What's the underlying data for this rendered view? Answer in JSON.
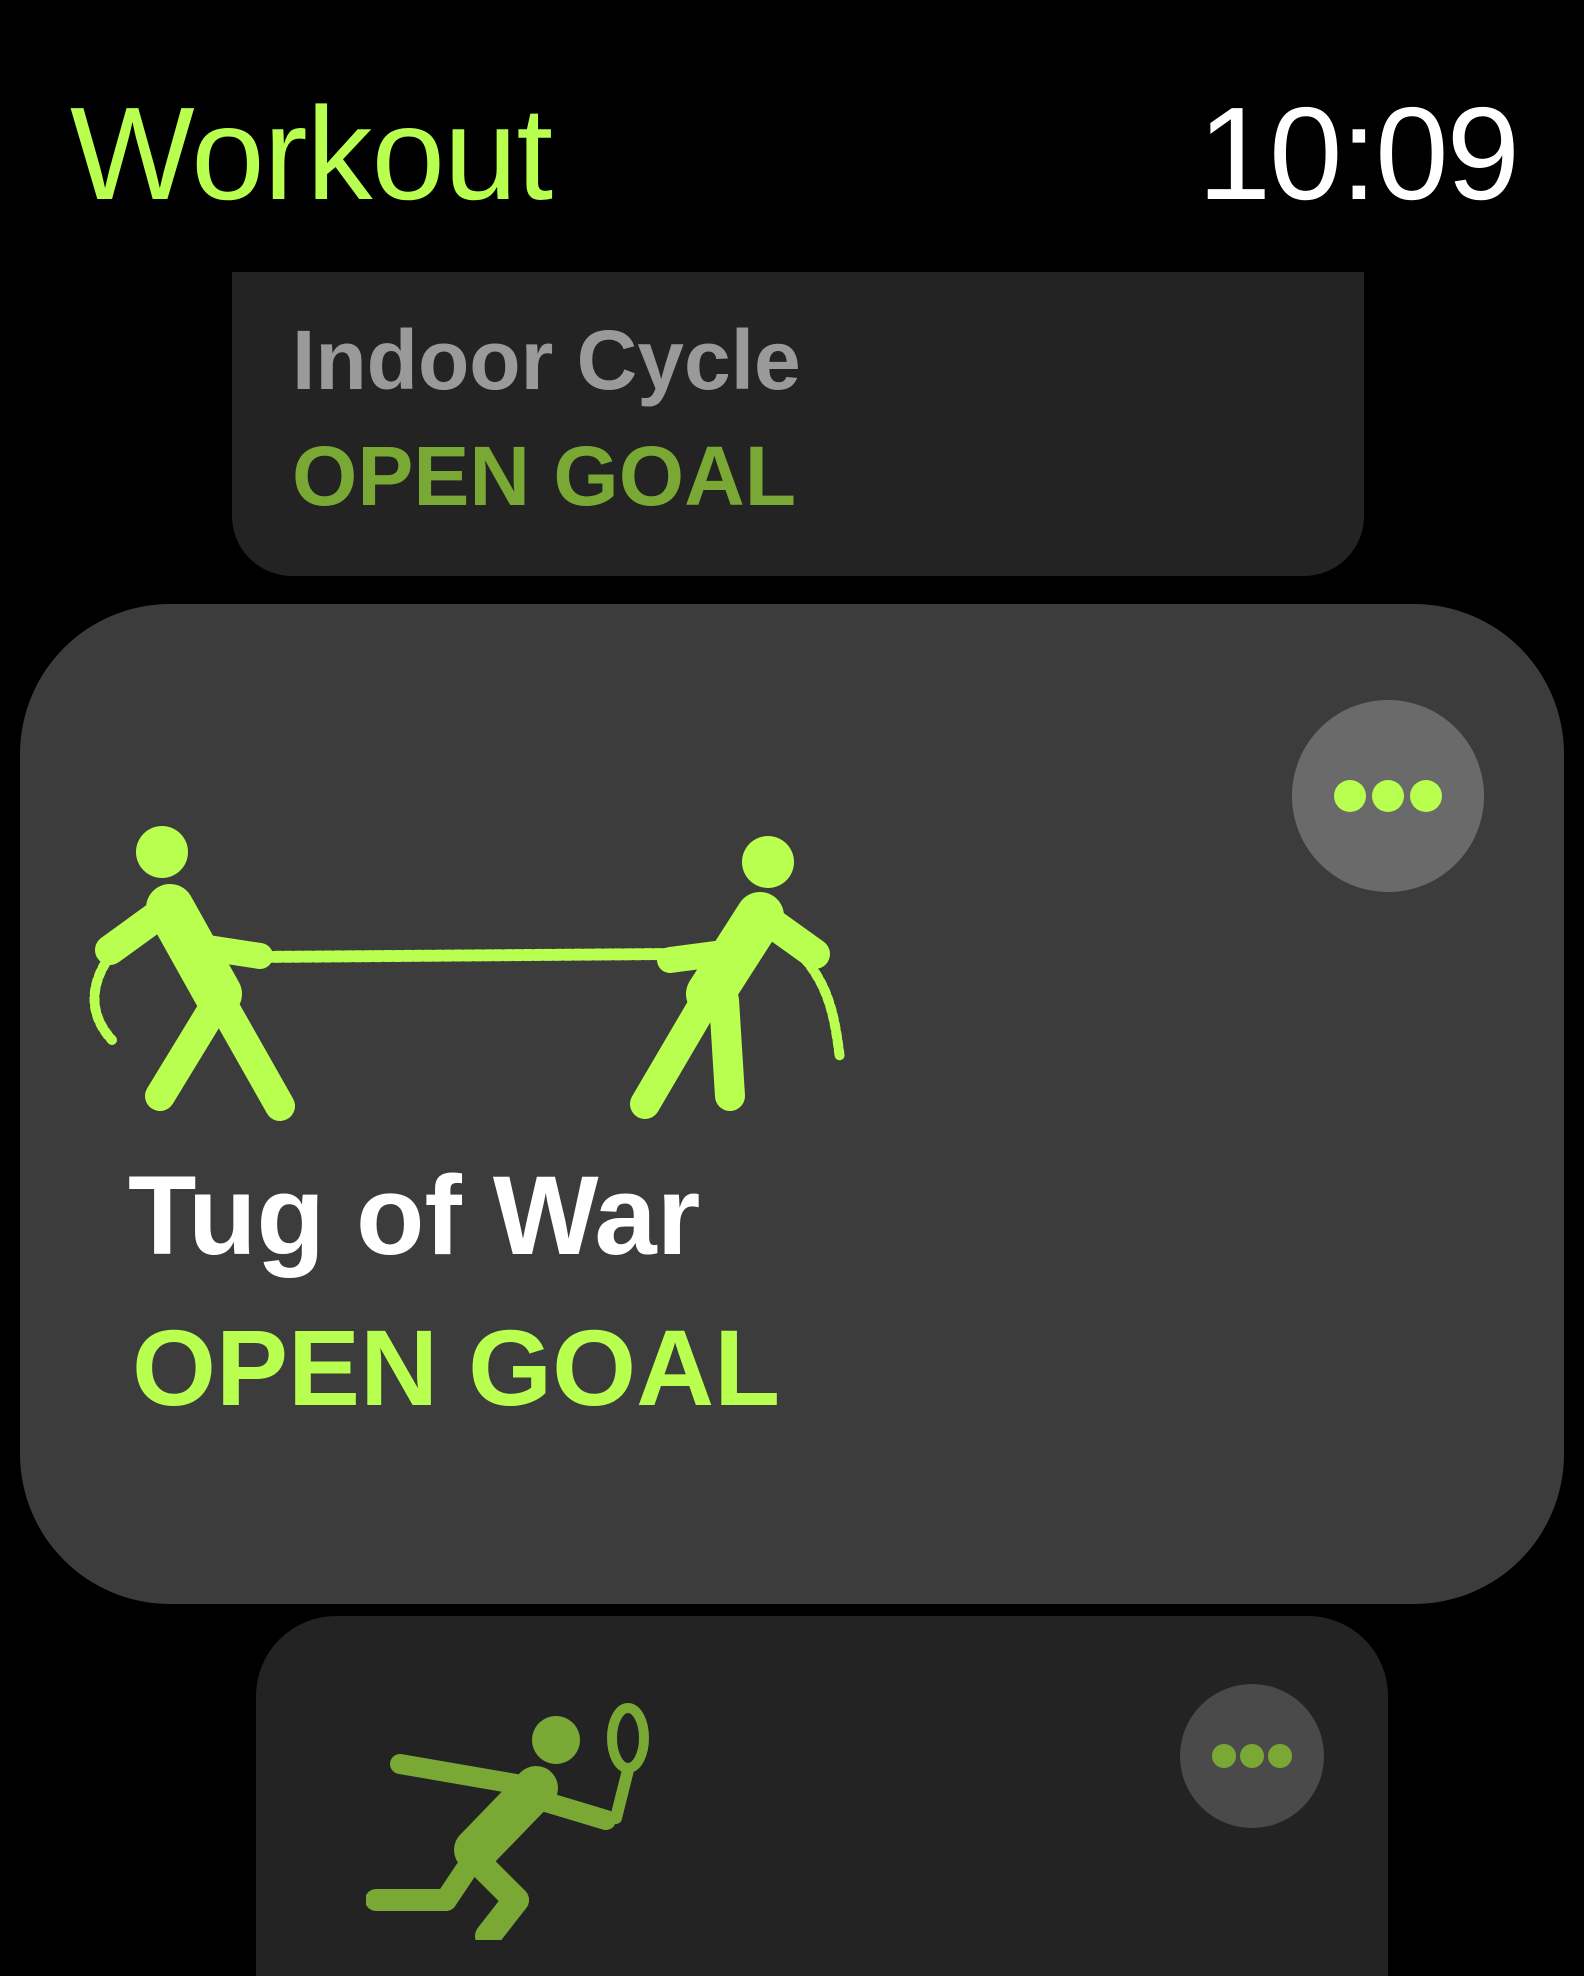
{
  "header": {
    "app_title": "Workout",
    "time": "10:09"
  },
  "colors": {
    "accent": "#b9ff4f",
    "accent_dim": "#7aa834",
    "card_bg": "#3c3c3c",
    "card_bg_dim": "#232323",
    "muted_text": "#9a9a9a"
  },
  "workouts": [
    {
      "title": "Indoor Cycle",
      "goal": "OPEN GOAL",
      "icon": "indoor-cycle-icon"
    },
    {
      "title": "Tug of War",
      "goal": "OPEN GOAL",
      "icon": "tug-of-war-icon",
      "more_icon": "more-ellipsis-icon"
    },
    {
      "icon": "racquet-sport-icon",
      "more_icon": "more-ellipsis-icon"
    }
  ]
}
